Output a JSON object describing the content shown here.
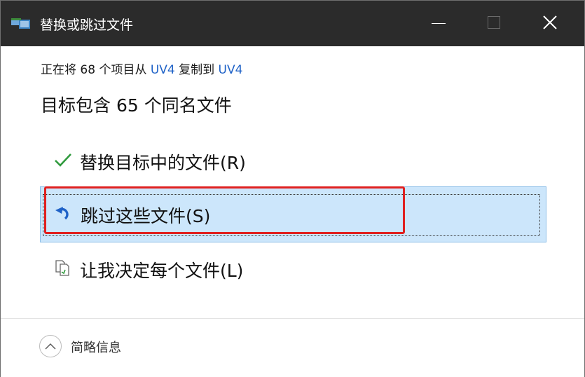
{
  "window": {
    "title": "替换或跳过文件",
    "icon": "copy-files-icon"
  },
  "title_buttons": {
    "minimize": "minimize-icon",
    "maximize": "maximize-icon",
    "close": "close-icon"
  },
  "subtitle": {
    "prefix": "正在将 68 个项目从 ",
    "source": "UV4",
    "middle": " 复制到 ",
    "destination": "UV4"
  },
  "heading": "目标包含 65 个同名文件",
  "options": [
    {
      "label": "替换目标中的文件(R)",
      "icon": "checkmark-icon",
      "icon_color": "#2f9a3d"
    },
    {
      "label": "跳过这些文件(S)",
      "icon": "skip-arrow-icon",
      "icon_color": "#1f62c7",
      "selected": true
    },
    {
      "label": "让我决定每个文件(L)",
      "icon": "files-compare-icon"
    }
  ],
  "highlight_color": "#e02020",
  "footer": {
    "label": "简略信息",
    "icon": "chevron-up-icon"
  }
}
